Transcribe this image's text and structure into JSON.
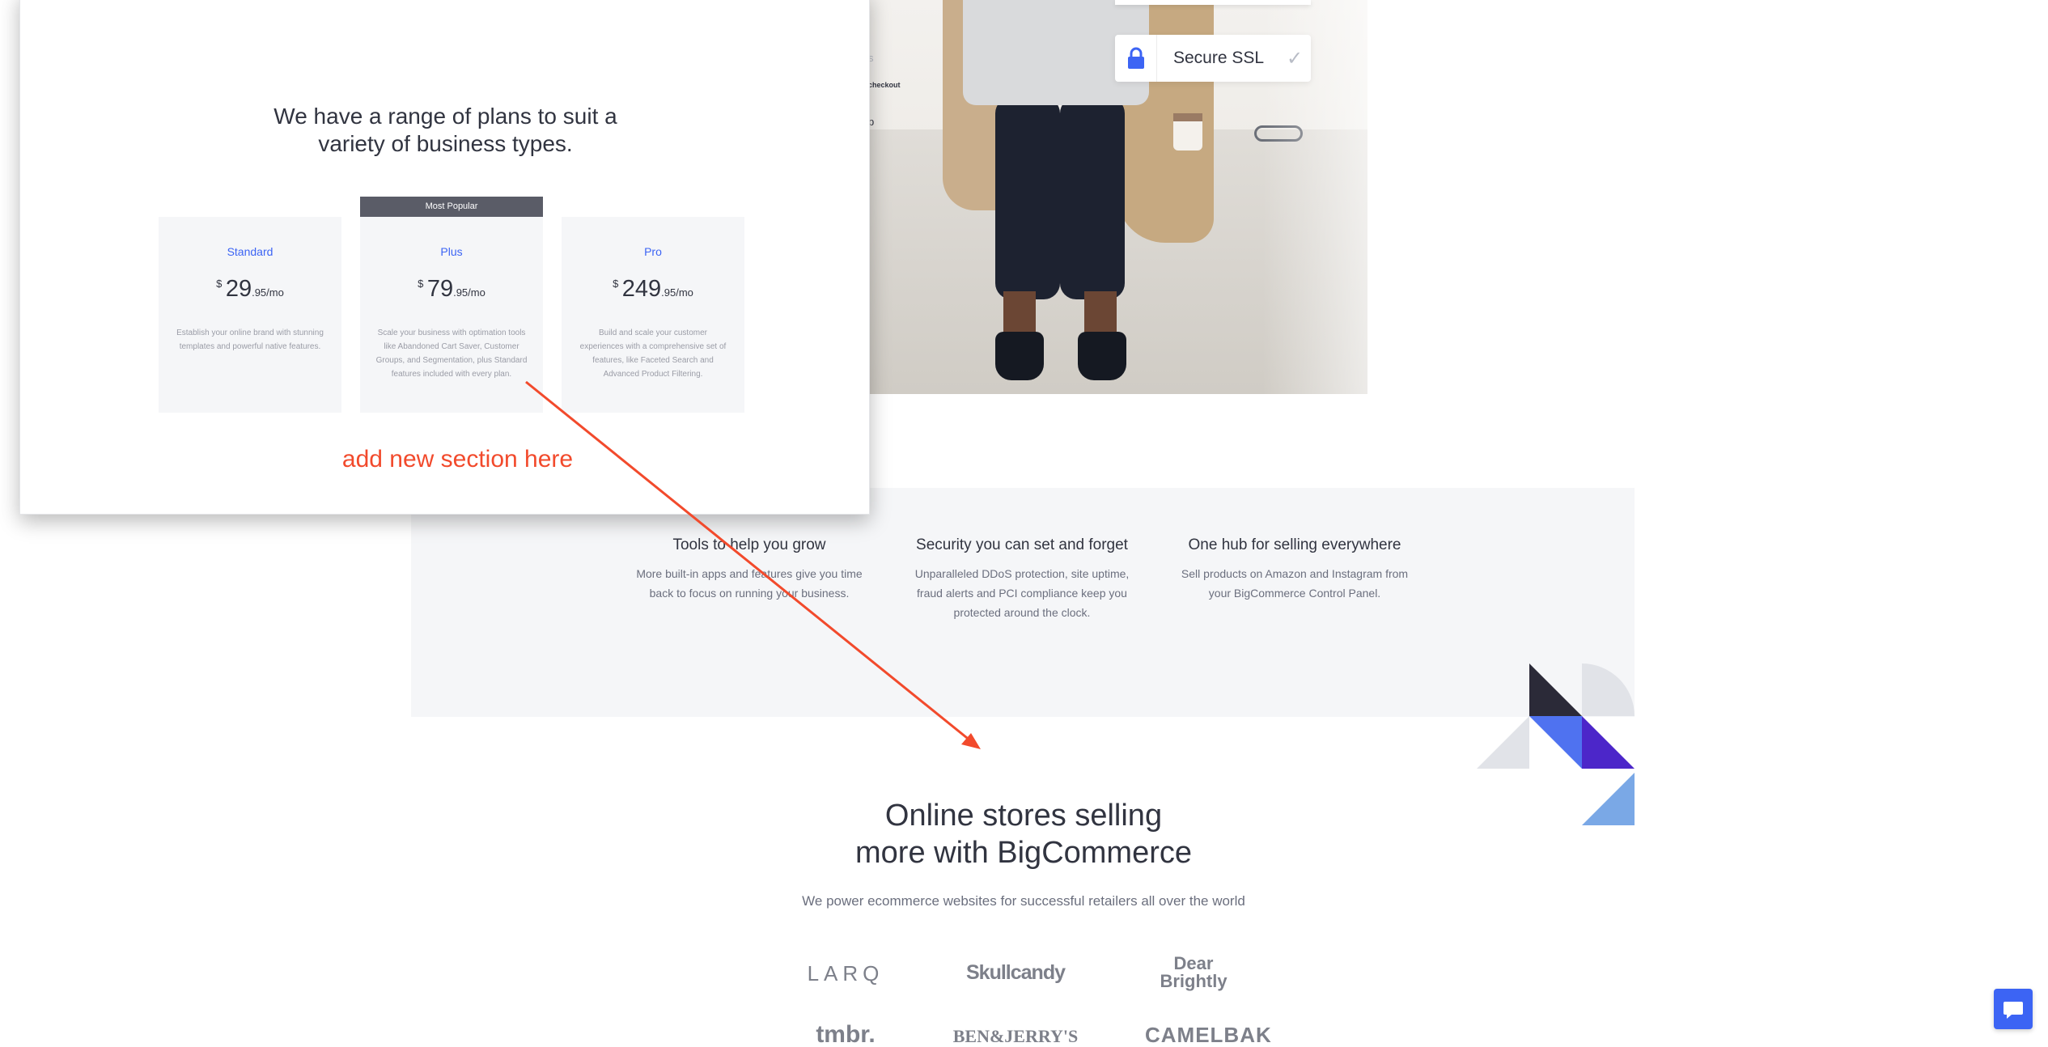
{
  "hero": {
    "ssl_label": "Secure SSL",
    "peek_texts": [
      "s",
      "checkout",
      "p"
    ]
  },
  "features": [
    {
      "title": "Tools to help you grow",
      "desc": "More built-in apps and features give you time back to focus on running your business."
    },
    {
      "title": "Security you can set and forget",
      "desc": "Unparalleled DDoS protection, site uptime, fraud alerts and PCI compliance keep you protected around the clock."
    },
    {
      "title": "One hub for selling everywhere",
      "desc": "Sell products on Amazon and Instagram from your BigCommerce Control Panel."
    }
  ],
  "stores": {
    "title_line1": "Online stores selling",
    "title_line2": "more with BigCommerce",
    "subtitle": "We power ecommerce websites for successful retailers all over the world",
    "brands": [
      "LARQ",
      "Skullcandy",
      "Dear Brightly",
      "tmbr.",
      "BEN&JERRY'S",
      "CAMELBAK"
    ]
  },
  "modal": {
    "heading_line1": "We have a range of plans to suit a",
    "heading_line2": "variety of business types.",
    "badge": "Most Popular",
    "plans": [
      {
        "name": "Standard",
        "currency": "$",
        "price": "29",
        "cents": ".95/mo",
        "desc": "Establish your online brand with stunning templates and powerful native features."
      },
      {
        "name": "Plus",
        "currency": "$",
        "price": "79",
        "cents": ".95/mo",
        "desc": "Scale your business with optimation tools like Abandoned Cart Saver, Customer Groups, and Segmentation, plus Standard features included with every plan."
      },
      {
        "name": "Pro",
        "currency": "$",
        "price": "249",
        "cents": ".95/mo",
        "desc": "Build and scale your customer experiences with a comprehensive set of features, like Faceted Search and Advanced Product Filtering."
      }
    ],
    "annotation": "add new section here"
  },
  "colors": {
    "accent": "#3c64f4",
    "annotation": "#f24a2c",
    "band": "#f5f6f8",
    "badge": "#5a5c67"
  },
  "icons": [
    "lock-icon",
    "check-icon",
    "chat-icon",
    "arrow-annotation-icon"
  ]
}
